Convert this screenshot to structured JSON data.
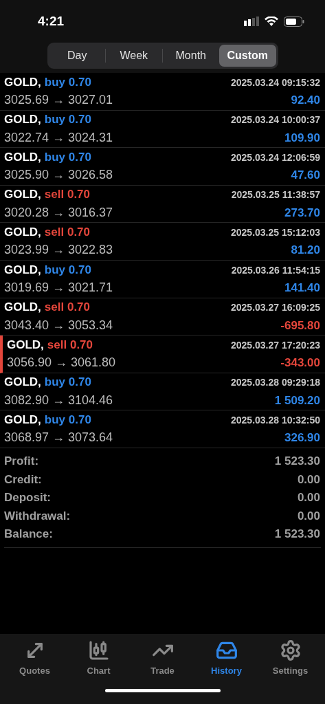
{
  "status_bar": {
    "time": "4:21"
  },
  "periods": [
    {
      "label": "Day",
      "selected": false
    },
    {
      "label": "Week",
      "selected": false
    },
    {
      "label": "Month",
      "selected": false
    },
    {
      "label": "Custom",
      "selected": true
    }
  ],
  "trades": [
    {
      "symbol": "GOLD,",
      "kind": "buy",
      "order": "buy 0.70",
      "time": "2025.03.24 09:15:32",
      "prices": "3025.69 → 3027.01",
      "profit": "92.40",
      "loss": false,
      "marked": false
    },
    {
      "symbol": "GOLD,",
      "kind": "buy",
      "order": "buy 0.70",
      "time": "2025.03.24 10:00:37",
      "prices": "3022.74 → 3024.31",
      "profit": "109.90",
      "loss": false,
      "marked": false
    },
    {
      "symbol": "GOLD,",
      "kind": "buy",
      "order": "buy 0.70",
      "time": "2025.03.24 12:06:59",
      "prices": "3025.90 → 3026.58",
      "profit": "47.60",
      "loss": false,
      "marked": false
    },
    {
      "symbol": "GOLD,",
      "kind": "sell",
      "order": "sell 0.70",
      "time": "2025.03.25 11:38:57",
      "prices": "3020.28 → 3016.37",
      "profit": "273.70",
      "loss": false,
      "marked": false
    },
    {
      "symbol": "GOLD,",
      "kind": "sell",
      "order": "sell 0.70",
      "time": "2025.03.25 15:12:03",
      "prices": "3023.99 → 3022.83",
      "profit": "81.20",
      "loss": false,
      "marked": false
    },
    {
      "symbol": "GOLD,",
      "kind": "buy",
      "order": "buy 0.70",
      "time": "2025.03.26 11:54:15",
      "prices": "3019.69 → 3021.71",
      "profit": "141.40",
      "loss": false,
      "marked": false
    },
    {
      "symbol": "GOLD,",
      "kind": "sell",
      "order": "sell 0.70",
      "time": "2025.03.27 16:09:25",
      "prices": "3043.40 → 3053.34",
      "profit": "-695.80",
      "loss": true,
      "marked": false
    },
    {
      "symbol": "GOLD,",
      "kind": "sell",
      "order": "sell 0.70",
      "time": "2025.03.27 17:20:23",
      "prices": "3056.90 → 3061.80",
      "profit": "-343.00",
      "loss": true,
      "marked": true
    },
    {
      "symbol": "GOLD,",
      "kind": "buy",
      "order": "buy 0.70",
      "time": "2025.03.28 09:29:18",
      "prices": "3082.90 → 3104.46",
      "profit": "1 509.20",
      "loss": false,
      "marked": false
    },
    {
      "symbol": "GOLD,",
      "kind": "buy",
      "order": "buy 0.70",
      "time": "2025.03.28 10:32:50",
      "prices": "3068.97 → 3073.64",
      "profit": "326.90",
      "loss": false,
      "marked": false
    }
  ],
  "summary": [
    {
      "label": "Profit:",
      "value": "1 523.30"
    },
    {
      "label": "Credit:",
      "value": "0.00"
    },
    {
      "label": "Deposit:",
      "value": "0.00"
    },
    {
      "label": "Withdrawal:",
      "value": "0.00"
    },
    {
      "label": "Balance:",
      "value": "1 523.30"
    }
  ],
  "tab_bar": [
    {
      "kind": "quotes",
      "label": "Quotes",
      "selected": false
    },
    {
      "kind": "chart",
      "label": "Chart",
      "selected": false
    },
    {
      "kind": "trade",
      "label": "Trade",
      "selected": false
    },
    {
      "kind": "history",
      "label": "History",
      "selected": true
    },
    {
      "kind": "settings",
      "label": "Settings",
      "selected": false
    }
  ]
}
